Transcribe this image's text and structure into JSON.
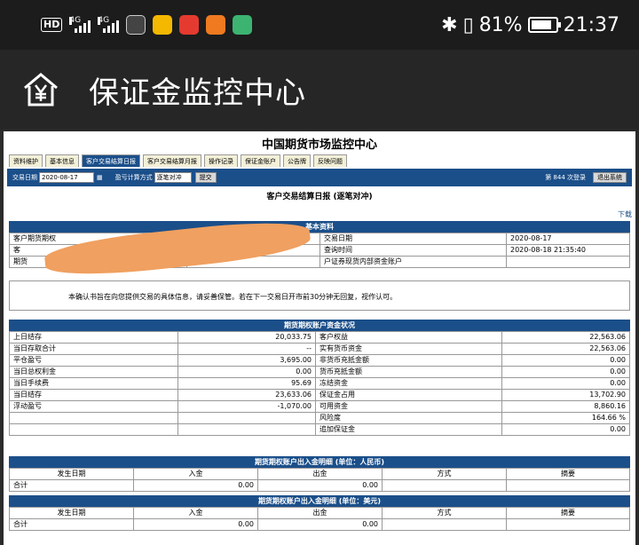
{
  "status_bar": {
    "hd": "HD",
    "network_1": "4G",
    "network_2": "4G",
    "battery_percent": "81%",
    "time": "21:37"
  },
  "header": {
    "title": "保证金监控中心"
  },
  "site": {
    "title": "中国期货市场监控中心"
  },
  "tabs": [
    {
      "label": "资料维护"
    },
    {
      "label": "基本信息"
    },
    {
      "label": "客户交易结算日报"
    },
    {
      "label": "客户交易结算月报"
    },
    {
      "label": "操作记录"
    },
    {
      "label": "保证金账户"
    },
    {
      "label": "公告牌"
    },
    {
      "label": "反映问题"
    }
  ],
  "toolbar": {
    "date_label": "交易日期",
    "date_value": "2020-08-17",
    "pl_label": "盈亏计算方式",
    "pl_value": "逐笔对冲",
    "submit_label": "提交",
    "login_count": "第 844 次登录",
    "logout_label": "退出系统"
  },
  "report": {
    "title": "客户交易结算日报 (逐笔对冲)",
    "download": "下载"
  },
  "basic": {
    "head": "基本资料",
    "left_1": "客户期货期权",
    "left_2": "客",
    "left_3": "期货",
    "trade_date_label": "交易日期",
    "trade_date": "2020-08-17",
    "query_time_label": "查询时间",
    "query_time": "2020-08-18 21:35:40",
    "account_label": "户证券现货内部资金账户"
  },
  "notice": {
    "text": "本确认书旨在向您提供交易的具体信息，请妥善保管。若在下一交易日开市前30分钟无回复，视作认可。"
  },
  "funds": {
    "head": "期货期权账户资金状况",
    "rows": [
      {
        "l": "上日结存",
        "lv": "20,033.75",
        "r": "客户权益",
        "rv": "22,563.06"
      },
      {
        "l": "当日存取合计",
        "lv": "--",
        "r": "实有货币资金",
        "rv": "22,563.06"
      },
      {
        "l": "平仓盈亏",
        "lv": "3,695.00",
        "r": "非货币充抵金额",
        "rv": "0.00"
      },
      {
        "l": "当日总权利金",
        "lv": "0.00",
        "r": "货币充抵金额",
        "rv": "0.00"
      },
      {
        "l": "当日手续费",
        "lv": "95.69",
        "r": "冻结资金",
        "rv": "0.00"
      },
      {
        "l": "当日结存",
        "lv": "23,633.06",
        "r": "保证金占用",
        "rv": "13,702.90"
      },
      {
        "l": "浮动盈亏",
        "lv": "-1,070.00",
        "r": "可用资金",
        "rv": "8,860.16"
      },
      {
        "l": "",
        "lv": "",
        "r": "风险度",
        "rv": "164.66 %"
      },
      {
        "l": "",
        "lv": "",
        "r": "追加保证金",
        "rv": "0.00"
      }
    ]
  },
  "cny": {
    "head": "期货期权账户出入金明细 (单位：人民币)",
    "cols": [
      "发生日期",
      "入金",
      "出金",
      "方式",
      "摘要"
    ],
    "total_label": "合计",
    "in_total": "0.00",
    "out_total": "0.00"
  },
  "usd": {
    "head": "期货期权账户出入金明细 (单位：美元)",
    "cols": [
      "发生日期",
      "入金",
      "出金",
      "方式",
      "摘要"
    ],
    "total_label": "合计",
    "in_total": "0.00",
    "out_total": "0.00"
  }
}
